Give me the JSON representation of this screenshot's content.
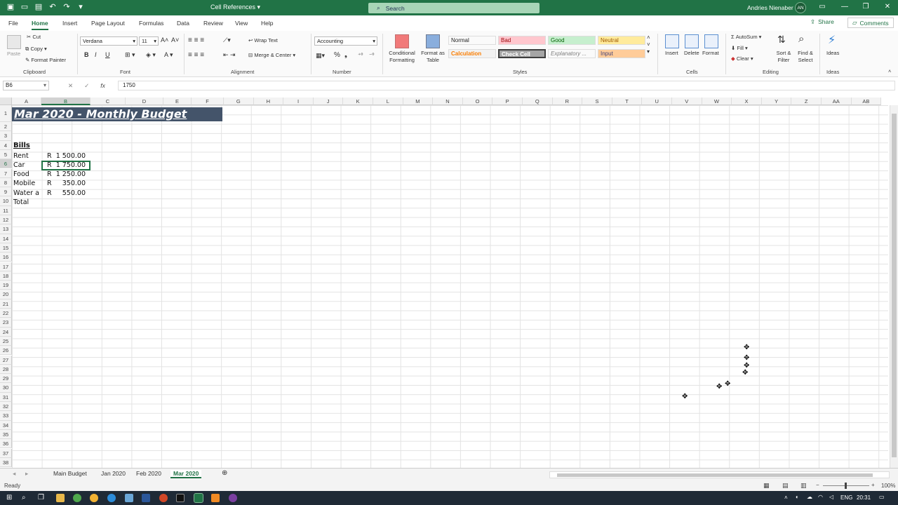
{
  "window": {
    "title": "Cell References",
    "search_placeholder": "Search",
    "user_name": "Andries Nienaber",
    "user_initials": "AN"
  },
  "ribbon_tabs": [
    "File",
    "Home",
    "Insert",
    "Page Layout",
    "Formulas",
    "Data",
    "Review",
    "View",
    "Help"
  ],
  "active_tab": "Home",
  "share_label": "Share",
  "comments_label": "Comments",
  "clipboard": {
    "paste": "Paste",
    "cut": "Cut",
    "copy": "Copy",
    "format_painter": "Format Painter",
    "label": "Clipboard"
  },
  "font": {
    "name": "Verdana",
    "size": "11",
    "label": "Font",
    "bold": "B",
    "italic": "I",
    "underline": "U"
  },
  "alignment": {
    "wrap_text": "Wrap Text",
    "merge_center": "Merge & Center",
    "label": "Alignment"
  },
  "number": {
    "format": "Accounting",
    "label": "Number",
    "percent": "%"
  },
  "styles": {
    "conditional": "Conditional Formatting",
    "format_table": "Format as Table",
    "label": "Styles",
    "items": [
      {
        "name": "Normal",
        "bg": "#ffffff",
        "fg": "#000000"
      },
      {
        "name": "Bad",
        "bg": "#ffc7ce",
        "fg": "#9c0006"
      },
      {
        "name": "Good",
        "bg": "#c6efce",
        "fg": "#006100"
      },
      {
        "name": "Neutral",
        "bg": "#ffeb9c",
        "fg": "#9c5700"
      },
      {
        "name": "Calculation",
        "bg": "#f2f2f2",
        "fg": "#fa7d00"
      },
      {
        "name": "Check Cell",
        "bg": "#a5a5a5",
        "fg": "#ffffff"
      },
      {
        "name": "Explanatory ...",
        "bg": "#ffffff",
        "fg": "#7f7f7f"
      },
      {
        "name": "Input",
        "bg": "#ffcc99",
        "fg": "#3f3f76"
      }
    ]
  },
  "cells_group": {
    "insert": "Insert",
    "delete": "Delete",
    "format": "Format",
    "label": "Cells"
  },
  "editing": {
    "autosum": "AutoSum",
    "fill": "Fill",
    "clear": "Clear",
    "sort_filter": "Sort & Filter",
    "find_select": "Find & Select",
    "label": "Editing"
  },
  "ideas": {
    "label": "Ideas",
    "button": "Ideas"
  },
  "formula_bar": {
    "name_box": "B6",
    "fx": "fx",
    "value": "1750"
  },
  "columns": [
    "A",
    "B",
    "C",
    "D",
    "E",
    "F",
    "G",
    "H",
    "I",
    "J",
    "K",
    "L",
    "M",
    "N",
    "O",
    "P",
    "Q",
    "R",
    "S",
    "T",
    "U",
    "V",
    "W",
    "X",
    "Y",
    "Z",
    "AA",
    "AB"
  ],
  "rows": [
    "1",
    "2",
    "3",
    "4",
    "5",
    "6",
    "7",
    "8",
    "9",
    "10",
    "11",
    "12",
    "13",
    "14",
    "15",
    "16",
    "17",
    "18",
    "19",
    "20",
    "21",
    "22",
    "23",
    "24",
    "25",
    "26",
    "27",
    "28",
    "29",
    "30",
    "31",
    "32",
    "33",
    "34",
    "35",
    "36",
    "37",
    "38"
  ],
  "sheet": {
    "title": "Mar 2020 - Monthly Budget",
    "section_header": "Bills",
    "bills": [
      {
        "label": "Rent",
        "currency": "R",
        "amount": "1 500.00"
      },
      {
        "label": "Car",
        "currency": "R",
        "amount": "1 750.00"
      },
      {
        "label": "Food",
        "currency": "R",
        "amount": "1 250.00"
      },
      {
        "label": "Mobile",
        "currency": "R",
        "amount": "350.00"
      },
      {
        "label": "Water a",
        "currency": "R",
        "amount": "550.00"
      }
    ],
    "total_label": "Total"
  },
  "sheet_tabs": [
    "Main Budget",
    "Jan 2020",
    "Feb 2020",
    "Mar 2020"
  ],
  "active_sheet": "Mar 2020",
  "status": {
    "ready": "Ready",
    "zoom": "100%"
  },
  "taskbar": {
    "language": "ENG",
    "time": "20:31"
  },
  "colors": {
    "accent": "#217346",
    "title_bg": "#44546a"
  }
}
